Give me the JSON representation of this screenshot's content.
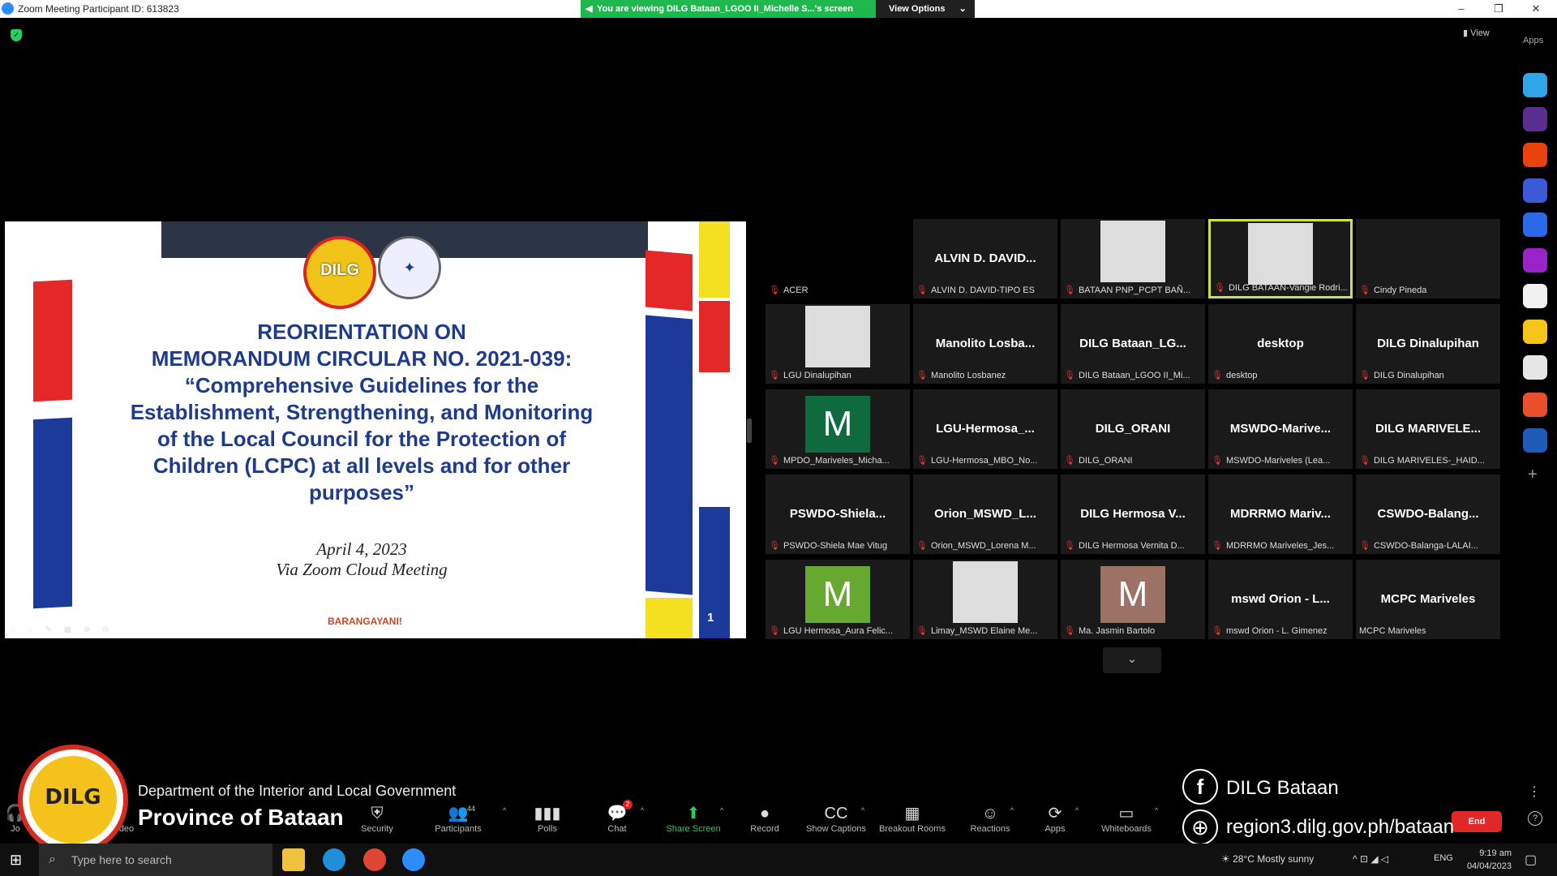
{
  "window": {
    "title": "Zoom Meeting Participant ID: 613823",
    "min": "–",
    "restore": "❐",
    "close": "✕"
  },
  "share_banner": {
    "text": "You are viewing DILG Bataan_LGOO II_Michelle S...'s screen",
    "speaker_icon": "speaker-icon",
    "options": "View Options",
    "caret": "⌄"
  },
  "top_right": {
    "view": "View",
    "apps": "Apps"
  },
  "slide": {
    "seal_a": "DILG",
    "title_lines": [
      "REORIENTATION ON",
      "MEMORANDUM CIRCULAR NO. 2021-039:",
      "“Comprehensive Guidelines for the",
      "Establishment, Strengthening, and Monitoring",
      "of the Local Council for the Protection of",
      "Children (LCPC) at all levels and for other",
      "purposes”"
    ],
    "date": "April 4, 2023",
    "venue": "Via Zoom Cloud Meeting",
    "brand": "BARANGAYANI!",
    "page": "1",
    "tools": "◌ ◌ ✎ ▦ ⊕ ⊖"
  },
  "participants": [
    {
      "name": "",
      "label": "ACER",
      "type": "black"
    },
    {
      "name": "ALVIN D. DAVID...",
      "label": "ALVIN D. DAVID-TIPO ES",
      "type": "text"
    },
    {
      "name": "",
      "label": "BATAAN PNP_PCPT BAÑ...",
      "type": "img"
    },
    {
      "name": "",
      "label": "DILG BATAAN-Vangie Rodri...",
      "type": "img",
      "active": true
    },
    {
      "name": "",
      "label": "Cindy Pineda",
      "type": "empty"
    },
    {
      "name": "",
      "label": "LGU Dinalupihan",
      "type": "img"
    },
    {
      "name": "Manolito Losba...",
      "label": "Manolito Losbanez",
      "type": "text"
    },
    {
      "name": "DILG Bataan_LG...",
      "label": "DILG Bataan_LGOO II_Mi...",
      "type": "text"
    },
    {
      "name": "desktop",
      "label": "desktop",
      "type": "text"
    },
    {
      "name": "DILG Dinalupihan",
      "label": "DILG Dinalupihan",
      "type": "text"
    },
    {
      "name": "M",
      "label": "MPDO_Mariveles_Micha...",
      "type": "avatar",
      "color": "#0f6b3e"
    },
    {
      "name": "LGU-Hermosa_...",
      "label": "LGU-Hermosa_MBO_No...",
      "type": "text"
    },
    {
      "name": "DILG_ORANI",
      "label": "DILG_ORANI",
      "type": "text"
    },
    {
      "name": "MSWDO-Marive...",
      "label": "MSWDO-Mariveles (Lea...",
      "type": "text"
    },
    {
      "name": "DILG MARIVELE...",
      "label": "DILG MARIVELES-_HAID...",
      "type": "text"
    },
    {
      "name": "PSWDO-Shiela...",
      "label": "PSWDO-Shiela Mae Vitug",
      "type": "text"
    },
    {
      "name": "Orion_MSWD_L...",
      "label": "Orion_MSWD_Lorena M...",
      "type": "text"
    },
    {
      "name": "DILG Hermosa V...",
      "label": "DILG Hermosa Vernita D...",
      "type": "text"
    },
    {
      "name": "MDRRMO Mariv...",
      "label": "MDRRMO Mariveles_Jes...",
      "type": "text"
    },
    {
      "name": "CSWDO-Balang...",
      "label": "CSWDO-Balanga-LALAI...",
      "type": "text"
    },
    {
      "name": "M",
      "label": "LGU Hermosa_Aura Felic...",
      "type": "avatar",
      "color": "#67a830"
    },
    {
      "name": "",
      "label": "Limay_MSWD Elaine Me...",
      "type": "img"
    },
    {
      "name": "M",
      "label": "Ma. Jasmin Bartolo",
      "type": "avatar",
      "color": "#9c7265"
    },
    {
      "name": "mswd Orion - L...",
      "label": "mswd Orion - L. Gimenez",
      "type": "text"
    },
    {
      "name": "MCPC Mariveles",
      "label": "MCPC Mariveles",
      "type": "text",
      "nomic": true
    }
  ],
  "grid_more": "⌄",
  "toolbar": {
    "items": [
      {
        "label": "Security",
        "icon": "⛨"
      },
      {
        "label": "Participants",
        "icon": "👥",
        "count": "44"
      },
      {
        "label": "Polls",
        "icon": "▮▮▮"
      },
      {
        "label": "Chat",
        "icon": "💬",
        "badge": "2"
      },
      {
        "label": "Share Screen",
        "icon": "⬆",
        "green": true
      },
      {
        "label": "Record",
        "icon": "●"
      },
      {
        "label": "Show Captions",
        "icon": "CC"
      },
      {
        "label": "Breakout Rooms",
        "icon": "▦"
      },
      {
        "label": "Reactions",
        "icon": "☺"
      },
      {
        "label": "Apps",
        "icon": "⟳"
      },
      {
        "label": "Whiteboards",
        "icon": "▭"
      }
    ],
    "partial_left": "Jo",
    "partial_video": "deo",
    "end": "End",
    "more": "⋮",
    "help": "?"
  },
  "overlay": {
    "logo": "DILG",
    "dept": "Department of the Interior and Local Government",
    "province": "Province of Bataan",
    "fb_icon": "f",
    "fb": "DILG Bataan",
    "web_icon": "⊕",
    "web": "region3.dilg.gov.ph/bataan"
  },
  "taskbar": {
    "start": "⊞",
    "search_icon": "⌕",
    "search_placeholder": "Type here to search",
    "weather_temp": "28°C",
    "weather_text": "Mostly sunny",
    "tray": "^ ⊡ ◢ ◁",
    "lang": "ENG",
    "time": "9:19 am",
    "date": "04/04/2023",
    "notif": "▢"
  }
}
